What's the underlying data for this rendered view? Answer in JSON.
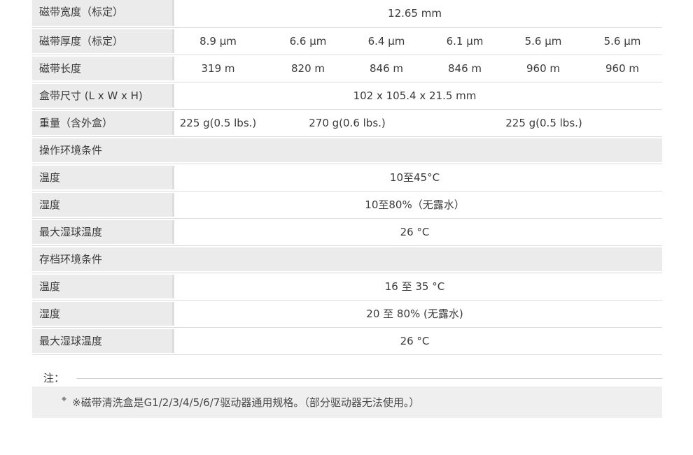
{
  "rows": [
    {
      "label": "磁带宽度（标定）",
      "value": "12.65 mm"
    },
    {
      "label": "磁带厚度（标定）",
      "values": [
        "8.9 µm",
        "6.6 µm",
        "6.4 µm",
        "6.1 µm",
        "5.6 µm",
        "5.6 µm"
      ]
    },
    {
      "label": "磁带长度",
      "values": [
        "319 m",
        "820 m",
        "846 m",
        "846 m",
        "960 m",
        "960 m"
      ]
    },
    {
      "label": "盒带尺寸 (L x W x H)",
      "value": "102 x 105.4 x 21.5 mm"
    },
    {
      "label": "重量（含外盒）",
      "values": [
        "225 g(0.5 lbs.)",
        "270 g(0.6 lbs.)",
        "225 g(0.5 lbs.)"
      ]
    }
  ],
  "operating": {
    "title": "操作环境条件",
    "temperature": {
      "label": "温度",
      "value": "10至45°C"
    },
    "humidity": {
      "label": "湿度",
      "value": "10至80%（无露水）"
    },
    "wet_bulb": {
      "label": "最大湿球温度",
      "value": "26 °C"
    }
  },
  "archive": {
    "title": "存档环境条件",
    "temperature": {
      "label": "温度",
      "value": "16 至 35 °C"
    },
    "humidity": {
      "label": "湿度",
      "value": "20 至 80% (无露水)"
    },
    "wet_bulb": {
      "label": "最大湿球温度",
      "value": "26 °C"
    }
  },
  "notes": {
    "heading": "注：",
    "items": [
      "※磁带清洗盒是G1/2/3/4/5/6/7驱动器通用规格。（部分驱动器无法使用。）"
    ]
  }
}
